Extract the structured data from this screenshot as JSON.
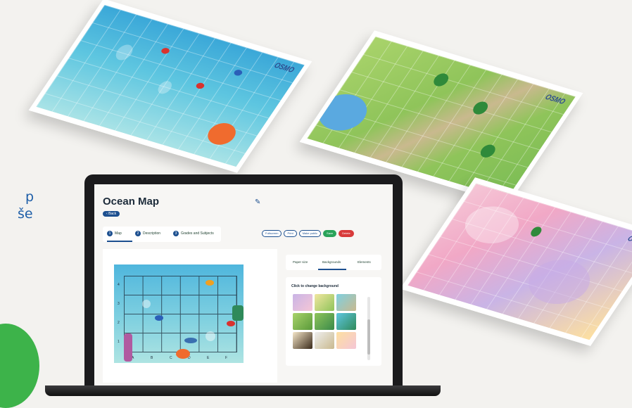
{
  "side_text": [
    "p",
    "še"
  ],
  "app": {
    "title": "Ocean Map",
    "back_label": "Back",
    "tabs": [
      {
        "num": "1",
        "label": "Map"
      },
      {
        "num": "2",
        "label": "Description"
      },
      {
        "num": "3",
        "label": "Grades and Subjects"
      }
    ],
    "actions": [
      "Fullscreen",
      "Print",
      "Make public",
      "Save",
      "Delete"
    ],
    "map": {
      "rows": [
        "4",
        "3",
        "2",
        "1"
      ],
      "cols": [
        "A",
        "B",
        "C",
        "D",
        "E",
        "F"
      ]
    },
    "right_panel": {
      "tabs": [
        "Paper size",
        "Backgrounds",
        "Elements"
      ],
      "bg_title": "Click to change background"
    }
  },
  "mats": {
    "logo": "OSMO"
  },
  "colors": {
    "accent": "#1c4f8f",
    "save": "#2aa35a",
    "delete": "#d83a3a",
    "green": "#3db34a"
  }
}
